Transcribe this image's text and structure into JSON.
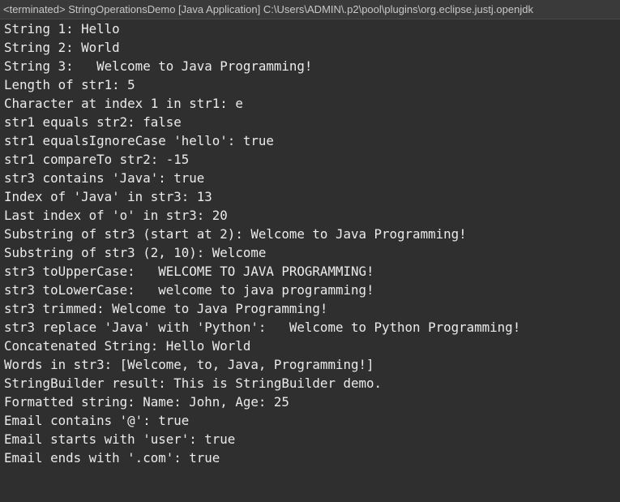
{
  "console": {
    "header_title": "<terminated> StringOperationsDemo [Java Application] C:\\Users\\ADMIN\\.p2\\pool\\plugins\\org.eclipse.justj.openjdk",
    "lines": [
      "String 1: Hello",
      "String 2: World",
      "String 3:   Welcome to Java Programming!  ",
      "Length of str1: 5",
      "Character at index 1 in str1: e",
      "str1 equals str2: false",
      "str1 equalsIgnoreCase 'hello': true",
      "str1 compareTo str2: -15",
      "str3 contains 'Java': true",
      "Index of 'Java' in str3: 13",
      "Last index of 'o' in str3: 20",
      "Substring of str3 (start at 2): Welcome to Java Programming!",
      "Substring of str3 (2, 10): Welcome",
      "str3 toUpperCase:   WELCOME TO JAVA PROGRAMMING!",
      "str3 toLowerCase:   welcome to java programming!",
      "str3 trimmed: Welcome to Java Programming!",
      "str3 replace 'Java' with 'Python':   Welcome to Python Programming!",
      "Concatenated String: Hello World",
      "Words in str3: [Welcome, to, Java, Programming!]",
      "StringBuilder result: This is StringBuilder demo.",
      "Formatted string: Name: John, Age: 25",
      "Email contains '@': true",
      "Email starts with 'user': true",
      "Email ends with '.com': true"
    ]
  },
  "colors": {
    "background": "#2f2f2f",
    "header_background": "#3a3a3a",
    "text": "#ebebeb",
    "header_text": "#c8c8c8"
  }
}
